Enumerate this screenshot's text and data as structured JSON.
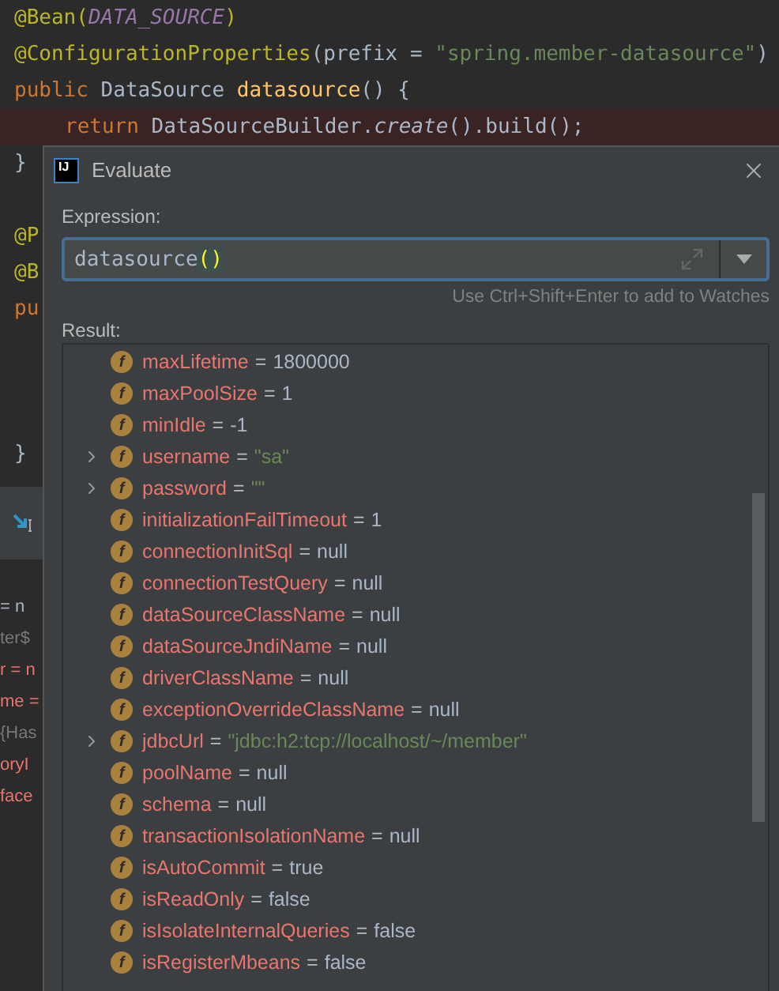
{
  "editor": {
    "code_lines": [
      {
        "highlighted": false,
        "kind": "top",
        "tokens": [
          {
            "text": "@Bean(",
            "kind": "annotation"
          },
          {
            "text": "DATA_SOURCE",
            "kind": "constant"
          },
          {
            "text": ")",
            "kind": "annotation"
          }
        ]
      },
      {
        "highlighted": false,
        "kind": "top",
        "tokens": [
          {
            "text": "@ConfigurationProperties",
            "kind": "annotation"
          },
          {
            "text": "(prefix = ",
            "kind": "plain"
          },
          {
            "text": "\"spring.member-datasource\"",
            "kind": "string"
          },
          {
            "text": ")",
            "kind": "plain"
          }
        ]
      },
      {
        "highlighted": false,
        "kind": "top",
        "tokens": [
          {
            "text": "public ",
            "kind": "keyword"
          },
          {
            "text": "DataSource ",
            "kind": "plain"
          },
          {
            "text": "datasource",
            "kind": "method"
          },
          {
            "text": "() {",
            "kind": "plain"
          }
        ]
      },
      {
        "highlighted": true,
        "kind": "nested",
        "tokens": [
          {
            "text": "return ",
            "kind": "keyword"
          },
          {
            "text": "DataSourceBuilder.",
            "kind": "plain"
          },
          {
            "text": "create",
            "kind": "italic"
          },
          {
            "text": "().build();",
            "kind": "plain"
          }
        ]
      }
    ],
    "side_lines": [
      {
        "text": "}",
        "kind": "plain"
      },
      {
        "kind": "blank"
      },
      {
        "text": "@P",
        "kind": "annotation"
      },
      {
        "text": "@B",
        "kind": "annotation"
      },
      {
        "text": "pu",
        "kind": "keyword"
      },
      {
        "kind": "blank"
      },
      {
        "kind": "blank"
      },
      {
        "kind": "blank"
      },
      {
        "text": "}",
        "kind": "plain"
      }
    ],
    "panel_lines": [
      {
        "text": "= n",
        "kind": "plain"
      },
      {
        "text": "ter$",
        "kind": "dim"
      },
      {
        "text": "r = n",
        "kind": "name"
      },
      {
        "text": "me =",
        "kind": "name"
      },
      {
        "text": "{Has",
        "kind": "dim"
      },
      {
        "text": "oryI",
        "kind": "name"
      },
      {
        "text": "face",
        "kind": "name"
      }
    ]
  },
  "dialog": {
    "logo_text": "IJ",
    "title": "Evaluate",
    "expression_label": "Expression:",
    "expression": [
      {
        "text": "datasource",
        "kind": "plain"
      },
      {
        "text": "()",
        "kind": "brace"
      }
    ],
    "hint": "Use Ctrl+Shift+Enter to add to Watches",
    "result_label": "Result:",
    "rows": [
      {
        "icon": "f",
        "name": "maxLifetime",
        "equals": "=",
        "value": "1800000",
        "kind": "plain",
        "expandable": false
      },
      {
        "icon": "f",
        "name": "maxPoolSize",
        "equals": "=",
        "value": "1",
        "kind": "plain",
        "expandable": false
      },
      {
        "icon": "f",
        "name": "minIdle",
        "equals": "=",
        "value": "-1",
        "kind": "plain",
        "expandable": false
      },
      {
        "icon": "f",
        "name": "username",
        "equals": "=",
        "value": "\"sa\"",
        "kind": "string",
        "expandable": true
      },
      {
        "icon": "f",
        "name": "password",
        "equals": "=",
        "value": "\"\"",
        "kind": "string",
        "expandable": true
      },
      {
        "icon": "f",
        "name": "initializationFailTimeout",
        "equals": "=",
        "value": "1",
        "kind": "plain",
        "expandable": false
      },
      {
        "icon": "f",
        "name": "connectionInitSql",
        "equals": "=",
        "value": "null",
        "kind": "plain",
        "expandable": false
      },
      {
        "icon": "f",
        "name": "connectionTestQuery",
        "equals": "=",
        "value": "null",
        "kind": "plain",
        "expandable": false
      },
      {
        "icon": "f",
        "name": "dataSourceClassName",
        "equals": "=",
        "value": "null",
        "kind": "plain",
        "expandable": false
      },
      {
        "icon": "f",
        "name": "dataSourceJndiName",
        "equals": "=",
        "value": "null",
        "kind": "plain",
        "expandable": false
      },
      {
        "icon": "f",
        "name": "driverClassName",
        "equals": "=",
        "value": "null",
        "kind": "plain",
        "expandable": false
      },
      {
        "icon": "f",
        "name": "exceptionOverrideClassName",
        "equals": "=",
        "value": "null",
        "kind": "plain",
        "expandable": false
      },
      {
        "icon": "f",
        "name": "jdbcUrl",
        "equals": "=",
        "value": "\"jdbc:h2:tcp://localhost/~/member\"",
        "kind": "string",
        "expandable": true
      },
      {
        "icon": "f",
        "name": "poolName",
        "equals": "=",
        "value": "null",
        "kind": "plain",
        "expandable": false
      },
      {
        "icon": "f",
        "name": "schema",
        "equals": "=",
        "value": "null",
        "kind": "plain",
        "expandable": false
      },
      {
        "icon": "f",
        "name": "transactionIsolationName",
        "equals": "=",
        "value": "null",
        "kind": "plain",
        "expandable": false
      },
      {
        "icon": "f",
        "name": "isAutoCommit",
        "equals": "=",
        "value": "true",
        "kind": "plain",
        "expandable": false
      },
      {
        "icon": "f",
        "name": "isReadOnly",
        "equals": "=",
        "value": "false",
        "kind": "plain",
        "expandable": false
      },
      {
        "icon": "f",
        "name": "isIsolateInternalQueries",
        "equals": "=",
        "value": "false",
        "kind": "plain",
        "expandable": false
      },
      {
        "icon": "f",
        "name": "isRegisterMbeans",
        "equals": "=",
        "value": "false",
        "kind": "plain",
        "expandable": false
      }
    ]
  }
}
